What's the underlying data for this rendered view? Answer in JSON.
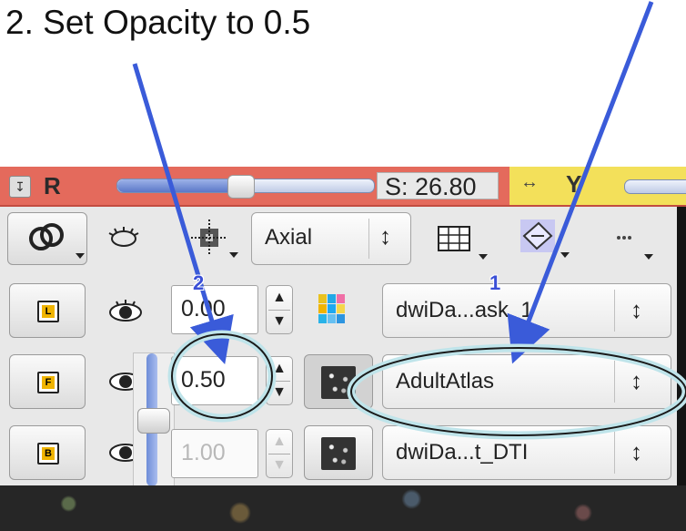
{
  "caption": "2.  Set Opacity to 0.5",
  "markers": {
    "step1": "1",
    "step2": "2"
  },
  "slice_controller": {
    "pin_icon": "pin-icon",
    "view_letter": "R",
    "slider_level": 0.48,
    "slice_offset": "S: 26.80",
    "linked_view_letter": "Y",
    "color": "#e46a5c"
  },
  "toolbar": {
    "link_icon": "link-rings-icon",
    "visibility_icon": "eye-outline-icon",
    "crosshair_icon": "crosshair-grid-icon",
    "orientation": "Axial",
    "layout_icon": "grid-layout-icon",
    "reformat_icon": "reformat-plane-icon",
    "more_icon": "more-options-icon"
  },
  "layers": {
    "label": {
      "badge": "L",
      "opacity": "0.00",
      "volume": "dwiDa...ask_1"
    },
    "foreground": {
      "badge": "F",
      "opacity": "0.50",
      "volume": "AdultAtlas"
    },
    "background": {
      "badge": "B",
      "opacity": "1.00",
      "volume": "dwiDa...t_DTI"
    }
  },
  "opacity_slider_level": 0.5,
  "colors": {
    "annotation": "#3a5bd9",
    "highlight_ellipse": "#bfe4ea",
    "slice_bar": "#e46a5c",
    "linked_bar": "#f3e05a"
  }
}
